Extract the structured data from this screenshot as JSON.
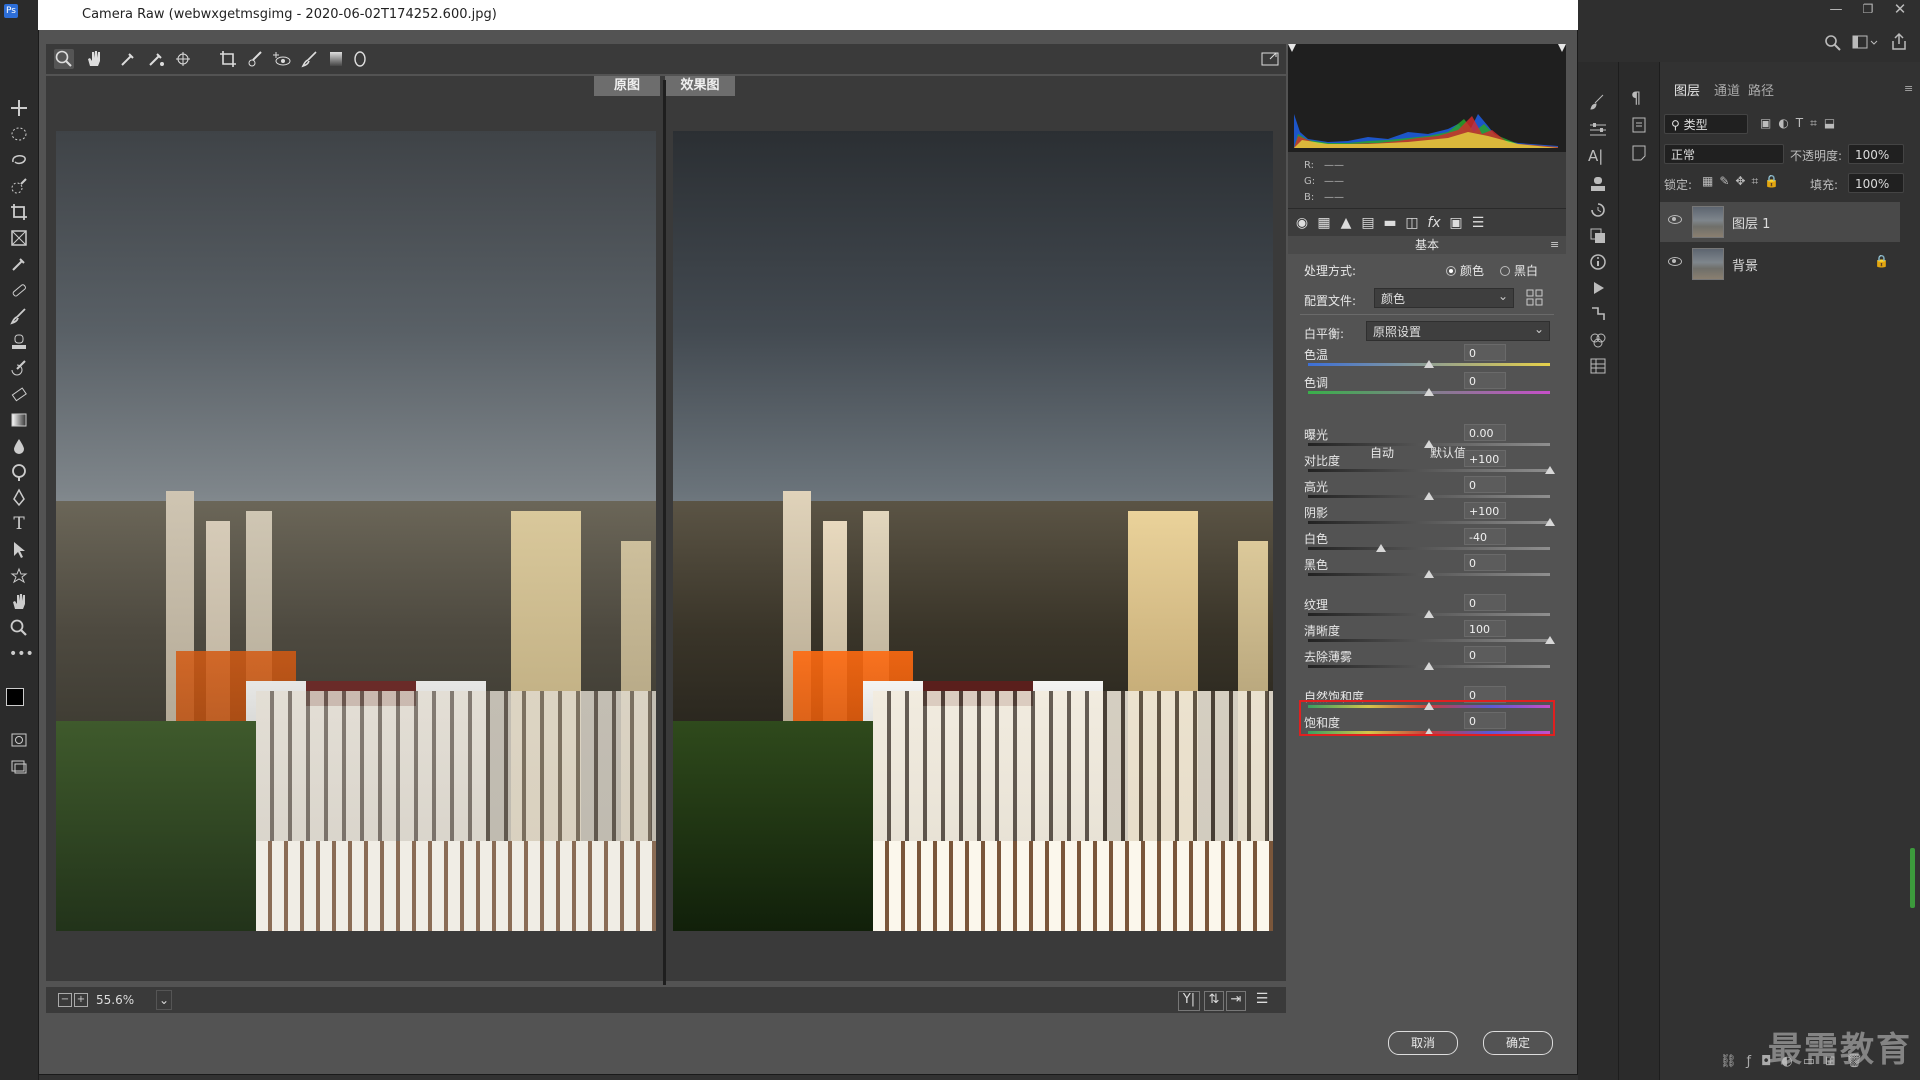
{
  "window": {
    "title": "Camera Raw (webwxgetmsgimg - 2020-06-02T174252.600.jpg)"
  },
  "view": {
    "before_tab": "原图",
    "after_tab": "效果图",
    "zoom": "55.6%"
  },
  "readout": {
    "r": "R:",
    "g": "G:",
    "b": "B:",
    "dash": "——"
  },
  "panel": {
    "heading": "基本",
    "treatment": {
      "label": "处理方式:",
      "color_option": "颜色",
      "bw_option": "黑白",
      "selected": "颜色"
    },
    "profile": {
      "label": "配置文件:",
      "value": "颜色"
    },
    "white_balance": {
      "label": "白平衡:",
      "value": "原照设置"
    },
    "auto_label": "自动",
    "default_label": "默认值",
    "sliders": [
      {
        "label": "色温",
        "value": "0",
        "pos": 0.5,
        "track": "temp"
      },
      {
        "label": "色调",
        "value": "0",
        "pos": 0.5,
        "track": "tint"
      },
      {
        "label": "曝光",
        "value": "0.00",
        "pos": 0.5,
        "track": "grad-dark"
      },
      {
        "label": "对比度",
        "value": "+100",
        "pos": 1.0,
        "track": "grad-dark"
      },
      {
        "label": "高光",
        "value": "0",
        "pos": 0.5,
        "track": "grad-dark"
      },
      {
        "label": "阴影",
        "value": "+100",
        "pos": 1.0,
        "track": "grad-dark"
      },
      {
        "label": "白色",
        "value": "-40",
        "pos": 0.3,
        "track": "grad-dark"
      },
      {
        "label": "黑色",
        "value": "0",
        "pos": 0.5,
        "track": "grad-dark"
      },
      {
        "label": "纹理",
        "value": "0",
        "pos": 0.5,
        "track": "grad-dark"
      },
      {
        "label": "清晰度",
        "value": "100",
        "pos": 1.0,
        "track": "grad-dark"
      },
      {
        "label": "去除薄雾",
        "value": "0",
        "pos": 0.5,
        "track": "grad-dark"
      },
      {
        "label": "自然饱和度",
        "value": "0",
        "pos": 0.5,
        "track": "sat"
      },
      {
        "label": "饱和度",
        "value": "0",
        "pos": 0.5,
        "track": "sat"
      }
    ]
  },
  "buttons": {
    "cancel": "取消",
    "ok": "确定"
  },
  "ps_layers_panel": {
    "tabs": [
      "图层",
      "通道",
      "路径"
    ],
    "filter_kind": "类型",
    "blend_mode": "正常",
    "opacity_label": "不透明度:",
    "opacity_value": "100%",
    "lock_label": "锁定:",
    "fill_label": "填充:",
    "fill_value": "100%",
    "layers": [
      {
        "name": "图层 1",
        "selected": true,
        "locked": false
      },
      {
        "name": "背景",
        "selected": false,
        "locked": true
      }
    ]
  },
  "watermark": "最需教育",
  "colors": {
    "highlight": "#e02020",
    "accent_track_temp_start": "#3c6fd8",
    "accent_track_temp_end": "#e6d04a"
  }
}
